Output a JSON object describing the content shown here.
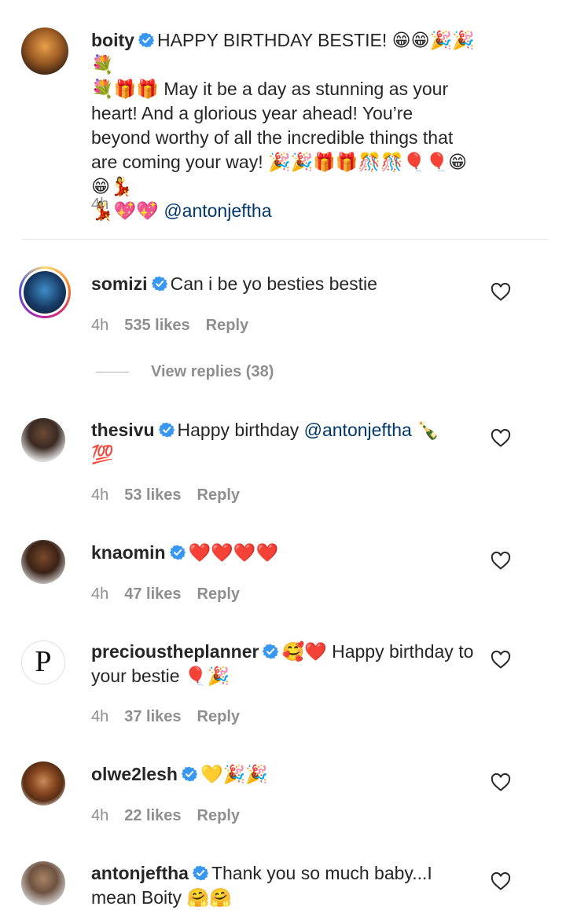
{
  "comments": [
    {
      "username": "boity",
      "text": "HAPPY BIRTHDAY BESTIE! 😁😁🎉🎉💐\n💐🎁🎁 May it be a day as stunning as your heart! And a glorious year ahead! You’re beyond worthy of all the incredible things that are coming your way! 🎉🎉🎁🎁🎊🎊🎈🎈😁😁💃\n💃💖💖",
      "mention": "@antonjeftha",
      "time": "4h"
    },
    {
      "username": "somizi",
      "text": "Can i be yo besties bestie",
      "time": "4h",
      "likes": "535 likes",
      "reply": "Reply",
      "view_replies": "View replies (38)"
    },
    {
      "username": "thesivu",
      "text": "Happy birthday ",
      "mention": "@antonjeftha",
      "text_after": " 🍾",
      "text_line2": "💯",
      "time": "4h",
      "likes": "53 likes",
      "reply": "Reply"
    },
    {
      "username": "knaomin",
      "text": "❤️❤️❤️❤️",
      "time": "4h",
      "likes": "47 likes",
      "reply": "Reply"
    },
    {
      "username": "precioustheplanner",
      "text": "🥰❤️ Happy birthday to your bestie 🎈🎉",
      "time": "4h",
      "likes": "37 likes",
      "reply": "Reply"
    },
    {
      "username": "olwe2lesh",
      "text": "💛🎉🎉",
      "time": "4h",
      "likes": "22 likes",
      "reply": "Reply"
    },
    {
      "username": "antonjeftha",
      "text": "Thank you so much baby...I mean Boity 🤗🤗"
    }
  ],
  "colors": {
    "verified": "#3897f0",
    "meta": "#8e8e8e",
    "mention": "#00376b",
    "heart_emoji": "#e0245e"
  },
  "icons": {
    "verified": "verified-badge-icon",
    "like": "heart-outline-icon"
  },
  "avatar_letters": {
    "precioustheplanner": "P"
  }
}
